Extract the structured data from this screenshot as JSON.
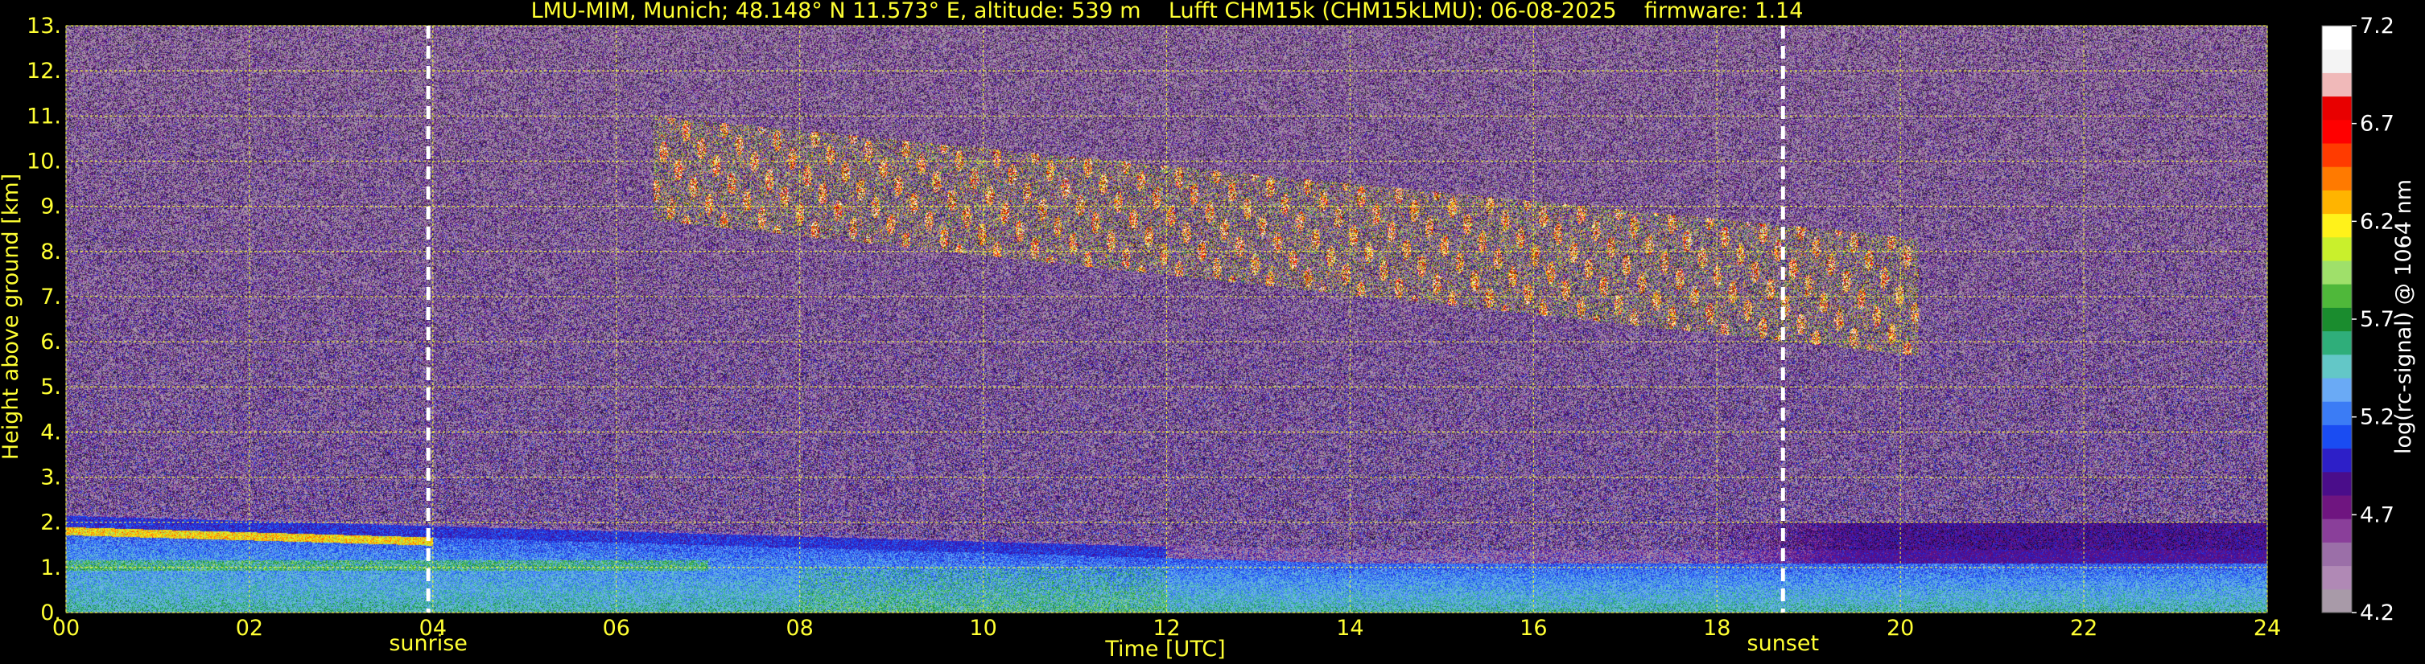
{
  "chart_data": {
    "type": "heatmap",
    "title": "LMU-MIM, Munich; 48.148° N 11.573° E, altitude: 539 m    Lufft CHM15k (CHM15kLMU): 06-08-2025    firmware: 1.14",
    "xlabel": "Time [UTC]",
    "ylabel": "Height above ground [km]",
    "colorbar_label": "log(rc-signal) @ 1064 nm",
    "xlim": [
      0,
      24
    ],
    "ylim": [
      0,
      13
    ],
    "clim": [
      4.2,
      7.2
    ],
    "grid": true,
    "x_ticks": [
      "00",
      "02",
      "04",
      "06",
      "08",
      "10",
      "12",
      "14",
      "16",
      "18",
      "20",
      "22",
      "24"
    ],
    "y_ticks": [
      "0.",
      "1.",
      "2.",
      "3.",
      "4.",
      "5.",
      "6.",
      "7.",
      "8.",
      "9.",
      "10.",
      "11.",
      "12.",
      "13."
    ],
    "colorbar_ticks": [
      "4.2",
      "4.7",
      "5.2",
      "5.7",
      "6.2",
      "6.7",
      "7.2"
    ],
    "events": [
      {
        "name": "sunrise",
        "time": 3.95
      },
      {
        "name": "sunset",
        "time": 18.72
      }
    ],
    "layers": [
      {
        "kind": "boundary-layer-aerosol",
        "t_start": 0,
        "t_end": 24,
        "base_km": 0,
        "top_km_start": 1.9,
        "top_km_end": 1.1
      },
      {
        "kind": "residual-layer",
        "t_start": 17.5,
        "t_end": 24,
        "base_km": 1.1,
        "top_km": 2.0
      },
      {
        "kind": "cirrus",
        "t_start": 6.4,
        "t_end": 20.2,
        "top_km_start": 10.7,
        "base_km_end": 6.3
      }
    ],
    "colormap": [
      "#a89aa8",
      "#b089b5",
      "#9b6fa8",
      "#8a3f9a",
      "#6f1580",
      "#4a0d8a",
      "#2d1fc8",
      "#1a4cf2",
      "#3b7cf5",
      "#6aaaf5",
      "#63c7c7",
      "#2fae7a",
      "#1a8c2e",
      "#4fb83a",
      "#9fe06a",
      "#c9f02c",
      "#fff21a",
      "#ffb400",
      "#ff7a00",
      "#ff3b00",
      "#ff0000",
      "#e80000",
      "#f0b9b9",
      "#f4f4f4",
      "#ffffff"
    ]
  }
}
